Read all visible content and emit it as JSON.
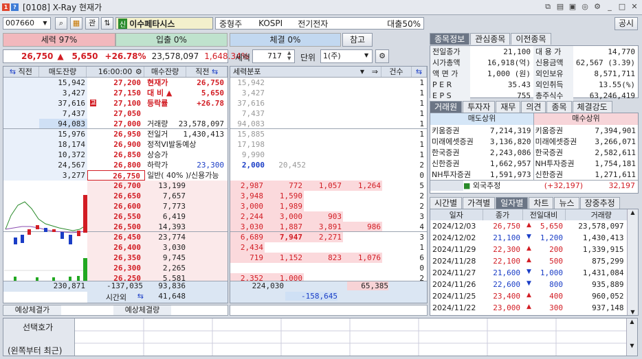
{
  "window": {
    "title": "[0108] X-Ray 현재가",
    "badge1": "1",
    "badge2": "?"
  },
  "toolbar": {
    "code": "007660",
    "kwan": "관",
    "company_badge": "신",
    "company": "이수페타시스",
    "tag1": "중형주",
    "tag2": "KOSPI",
    "tag3": "전기전자",
    "loan": "대출50%",
    "notice": "공시"
  },
  "strength": {
    "sell_label": "세력 97%",
    "entry_label": "입출 0%",
    "exec_label": "체결 0%",
    "ref_button": "참고"
  },
  "price": {
    "current": "26,750",
    "arrow": "▲",
    "change": "5,650",
    "rate": "+26.78%",
    "volume": "23,578,097",
    "ratio": "1,648.34%"
  },
  "ctrl": {
    "label_sellyuk": "세력",
    "count": "717",
    "label_unit": "단위",
    "unit": "1(주)"
  },
  "book": {
    "headers": {
      "prev": "직전",
      "sell_rem": "매도잔량",
      "time": "16:00:00",
      "buy_rem": "매수잔량",
      "prev2": "직전"
    },
    "asks": [
      {
        "rem": "15,942",
        "price": "27,200"
      },
      {
        "rem": "3,427",
        "price": "27,150"
      },
      {
        "rem": "37,616",
        "price": "27,100",
        "mark": "고"
      },
      {
        "rem": "7,437",
        "price": "27,050"
      },
      {
        "rem": "94,083",
        "price": "27,000"
      },
      {
        "rem": "15,976",
        "price": "26,950"
      },
      {
        "rem": "18,174",
        "price": "26,900"
      },
      {
        "rem": "10,372",
        "price": "26,850"
      },
      {
        "rem": "24,567",
        "price": "26,800"
      },
      {
        "rem": "3,277",
        "price": "26,750"
      }
    ],
    "bids": [
      {
        "price": "26,700",
        "rem": "13,199"
      },
      {
        "price": "26,650",
        "rem": "7,657"
      },
      {
        "price": "26,600",
        "rem": "7,773"
      },
      {
        "price": "26,550",
        "rem": "6,419"
      },
      {
        "price": "26,500",
        "rem": "14,393"
      },
      {
        "price": "26,450",
        "rem": "23,774"
      },
      {
        "price": "26,400",
        "rem": "3,030"
      },
      {
        "price": "26,350",
        "rem": "9,745"
      },
      {
        "price": "26,300",
        "rem": "2,265"
      },
      {
        "price": "26,250",
        "rem": "5,581"
      }
    ],
    "info": [
      {
        "k": "현재가",
        "v": "26,750"
      },
      {
        "k": "대 비 ▲",
        "v": "5,650"
      },
      {
        "k": "등락률",
        "v": "+26.78"
      },
      {
        "k": "",
        "v": ""
      },
      {
        "k": "거래량",
        "v": "23,578,097"
      },
      {
        "k": "전일거",
        "v": "1,430,413"
      },
      {
        "k": "정적VI발동예상",
        "v": ""
      },
      {
        "k": "상승가",
        "v": ""
      },
      {
        "k": "하락가",
        "v": "23,300"
      },
      {
        "k": "일반( 40% )/신용가능",
        "v": ""
      }
    ],
    "total_sell": "230,871",
    "total_diff": "-137,035",
    "total_buy": "93,836",
    "after_label": "시간외",
    "after_buy": "41,648"
  },
  "force": {
    "header": "세력분포",
    "cnt_header": "건수",
    "asks": [
      {
        "a": "15,942",
        "c": "1"
      },
      {
        "a": "3,427",
        "c": "1"
      },
      {
        "a": "37,616",
        "c": "1"
      },
      {
        "a": "7,437",
        "c": "1"
      },
      {
        "a": "94,083",
        "c": "1"
      },
      {
        "a": "15,885",
        "c": "1"
      },
      {
        "a": "17,198",
        "c": "1"
      },
      {
        "a": "9,990",
        "c": "1"
      },
      {
        "a": "2,000",
        "b": "20,452",
        "c": "2"
      },
      {
        "a": "",
        "c": "0"
      }
    ],
    "bids": [
      {
        "v": [
          "2,987",
          "772",
          "1,057",
          "1,264"
        ],
        "c": "5"
      },
      {
        "v": [
          "3,948",
          "1,590"
        ],
        "c": "2"
      },
      {
        "v": [
          "3,000",
          "1,989"
        ],
        "c": "2"
      },
      {
        "v": [
          "2,244",
          "3,000",
          "903"
        ],
        "c": "3"
      },
      {
        "v": [
          "3,030",
          "1,887",
          "3,891",
          "986"
        ],
        "c": "4"
      },
      {
        "v": [
          "6,689",
          "7,947",
          "2,271"
        ],
        "c": "3"
      },
      {
        "v": [
          "2,434"
        ],
        "c": "1"
      },
      {
        "v": [
          "719",
          "1,152",
          "823",
          "1,076"
        ],
        "c": "6"
      },
      {
        "v": [],
        "c": "0"
      },
      {
        "v": [
          "2,352",
          "1,000"
        ],
        "c": "2"
      }
    ],
    "sum1": "224,030",
    "sum2": "65,385",
    "sum3": "-158,645"
  },
  "expect": {
    "label1": "예상체결가",
    "label2": "예상체결량"
  },
  "selected": {
    "label": "선택호가",
    "sub": "(왼쪽부터 최근)"
  },
  "stock_tabs": [
    "종목정보",
    "관심종목",
    "이전종목"
  ],
  "stock_info": [
    {
      "k": "전일종가",
      "v": "21,100",
      "k2": "대 용 가",
      "v2": "14,770"
    },
    {
      "k": "시가총액",
      "v": "16,918(억)",
      "k2": "신용금액",
      "v2": "62,567  (3.39)"
    },
    {
      "k": "액 면 가",
      "v": "1,000 (원)",
      "k2": "외인보유",
      "v2": "8,571,711"
    },
    {
      "k": "P E R",
      "v": "35.43",
      "k2": "외인취득",
      "v2": "13.55(%)"
    },
    {
      "k": "E P S",
      "v": "755",
      "k2": "총주식수",
      "v2": "63,246,419"
    }
  ],
  "broker_tabs": [
    "거래원",
    "투자자",
    "재무",
    "의견",
    "종목",
    "체결강도"
  ],
  "brokers": {
    "sell_head": "매도상위",
    "buy_head": "매수상위",
    "rows": [
      {
        "s": "키움증권",
        "sv": "7,214,319",
        "b": "키움증권",
        "bv": "7,394,901"
      },
      {
        "s": "미래에셋증권",
        "sv": "3,136,820",
        "b": "미래에셋증권",
        "bv": "3,266,071"
      },
      {
        "s": "한국증권",
        "sv": "2,243,086",
        "b": "한국증권",
        "bv": "2,582,611"
      },
      {
        "s": "신한증권",
        "sv": "1,662,957",
        "b": "NH투자증권",
        "bv": "1,754,181"
      },
      {
        "s": "NH투자증권",
        "sv": "1,591,973",
        "b": "신한증권",
        "bv": "1,271,611"
      }
    ],
    "foreign_label": "외국추정",
    "foreign_diff": "(+32,197)",
    "foreign_val": "32,197"
  },
  "daily_tabs": [
    "시간별",
    "가격별",
    "일자별",
    "차트",
    "뉴스",
    "장중추정"
  ],
  "daily": {
    "headers": [
      "일자",
      "종가",
      "전일대비",
      "거래량"
    ],
    "rows": [
      {
        "d": "2024/12/03",
        "c": "26,750",
        "dir": "▲",
        "diff": "5,650",
        "v": "23,578,097"
      },
      {
        "d": "2024/12/02",
        "c": "21,100",
        "dir": "▼",
        "diff": "1,200",
        "v": "1,430,413"
      },
      {
        "d": "2024/11/29",
        "c": "22,300",
        "dir": "▲",
        "diff": "200",
        "v": "1,339,915"
      },
      {
        "d": "2024/11/28",
        "c": "22,100",
        "dir": "▲",
        "diff": "500",
        "v": "875,299"
      },
      {
        "d": "2024/11/27",
        "c": "21,600",
        "dir": "▼",
        "diff": "1,000",
        "v": "1,431,084"
      },
      {
        "d": "2024/11/26",
        "c": "22,600",
        "dir": "▼",
        "diff": "800",
        "v": "935,889"
      },
      {
        "d": "2024/11/25",
        "c": "23,400",
        "dir": "▲",
        "diff": "400",
        "v": "960,052"
      },
      {
        "d": "2024/11/22",
        "c": "23,000",
        "dir": "▲",
        "diff": "300",
        "v": "937,148"
      }
    ]
  }
}
